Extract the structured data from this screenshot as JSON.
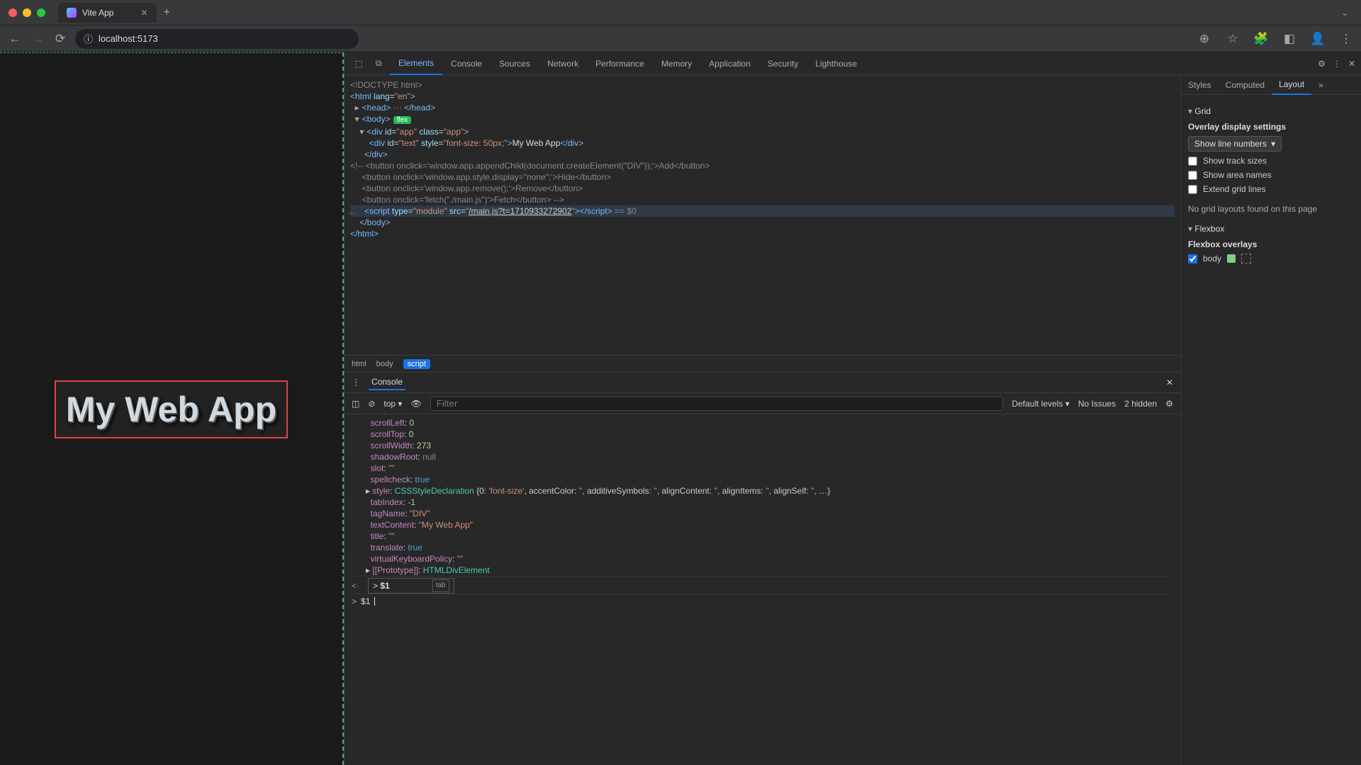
{
  "browser": {
    "tab_title": "Vite App",
    "url_display": "localhost:5173"
  },
  "page": {
    "hero_text": "My Web App"
  },
  "devtools": {
    "tabs": [
      "Elements",
      "Console",
      "Sources",
      "Network",
      "Performance",
      "Memory",
      "Application",
      "Security",
      "Lighthouse"
    ],
    "active_tab": "Elements",
    "breadcrumbs": [
      "html",
      "body",
      "script"
    ],
    "active_crumb": "script",
    "dom": {
      "doctype": "<!DOCTYPE html>",
      "html_open": "<html lang=\"en\">",
      "head": "<head>…</head>",
      "body_open": "<body>",
      "flex_badge": "flex",
      "app_open": "<div id=\"app\" class=\"app\">",
      "text_div": "<div id=\"text\" style=\"font-size: 50px;\">My Web App</div>",
      "app_close": "</div>",
      "comment1": "<!-- <button onclick='window.app.appendChild(document.createElement(\"DIV\"));'>Add</button>",
      "comment2": "     <button onclick='window.app.style.display=\"none\";'>Hide</button>",
      "comment3": "     <button onclick='window.app.remove();'>Remove</button>",
      "comment4": "     <button onclick='fetch(\"./main.js\")'>Fetch</button> -->",
      "script_line": "<script type=\"module\" src=\"/main.js?t=1710933272902\"></script>",
      "sel_suffix": " == $0",
      "body_close": "</body>",
      "html_close": "</html>"
    },
    "console": {
      "drawer_label": "Console",
      "context": "top",
      "filter_placeholder": "Filter",
      "levels": "Default levels",
      "issues": "No Issues",
      "hidden": "2 hidden",
      "props": [
        {
          "k": "scrollLeft",
          "v": "0",
          "t": "n"
        },
        {
          "k": "scrollTop",
          "v": "0",
          "t": "n"
        },
        {
          "k": "scrollWidth",
          "v": "273",
          "t": "n"
        },
        {
          "k": "shadowRoot",
          "v": "null",
          "t": "nu"
        },
        {
          "k": "slot",
          "v": "\"\"",
          "t": "s"
        },
        {
          "k": "spellcheck",
          "v": "true",
          "t": "b"
        },
        {
          "k": "style",
          "v": "CSSStyleDeclaration {0: 'font-size', accentColor: '', additiveSymbols: '', alignContent: '', alignItems: '', alignSelf: '', …}",
          "t": "obj"
        },
        {
          "k": "tabIndex",
          "v": "-1",
          "t": "n"
        },
        {
          "k": "tagName",
          "v": "\"DIV\"",
          "t": "s"
        },
        {
          "k": "textContent",
          "v": "\"My Web App\"",
          "t": "s"
        },
        {
          "k": "title",
          "v": "\"\"",
          "t": "s"
        },
        {
          "k": "translate",
          "v": "true",
          "t": "b"
        },
        {
          "k": "virtualKeyboardPolicy",
          "v": "\"\"",
          "t": "s"
        },
        {
          "k": "[[Prototype]]",
          "v": "HTMLDivElement",
          "t": "cls"
        }
      ],
      "autocomplete": "$1",
      "autocomplete_hint": "tab",
      "input_value": "$1"
    },
    "layout": {
      "side_tabs": [
        "Styles",
        "Computed",
        "Layout"
      ],
      "active_side": "Layout",
      "grid_header": "Grid",
      "overlay_header": "Overlay display settings",
      "line_numbers": "Show line numbers",
      "track_sizes": "Show track sizes",
      "area_names": "Show area names",
      "extend_lines": "Extend grid lines",
      "no_grid": "No grid layouts found on this page",
      "flexbox_header": "Flexbox",
      "flex_overlays": "Flexbox overlays",
      "body_label": "body"
    }
  }
}
